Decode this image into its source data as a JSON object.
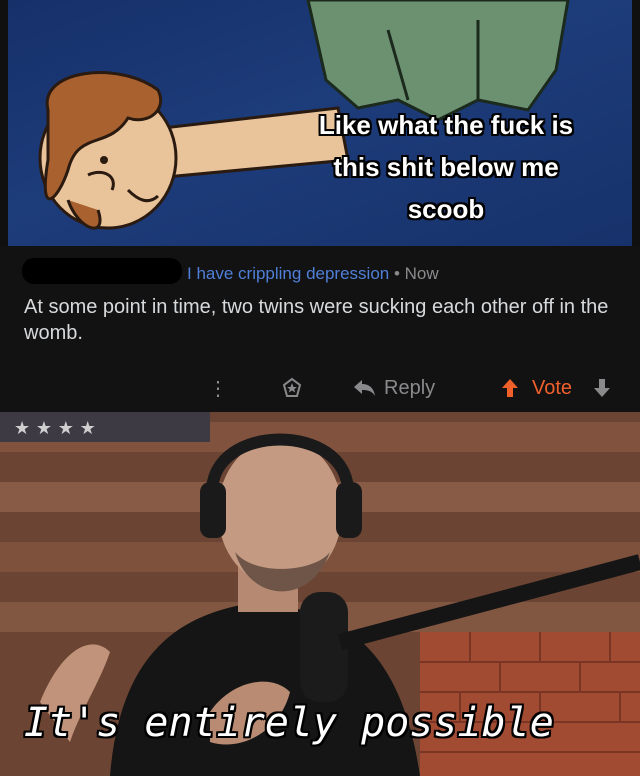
{
  "top_meme": {
    "caption": "Like what the fuck is\nthis shit below me\nscoob"
  },
  "comment": {
    "username": "I have crippling depression",
    "separator": " • ",
    "time": "Now",
    "body": "At some point in time, two twins were sucking each other off in the womb."
  },
  "actions": {
    "more_icon": "⋮",
    "reply_label": "Reply",
    "vote_label": "Vote"
  },
  "bottom_meme": {
    "caption": "It's entirely possible"
  },
  "colors": {
    "username": "#4f7fd8",
    "vote_accent": "#f0602b",
    "meta_gray": "#8a8a8c",
    "body_text": "#d7dadc"
  }
}
